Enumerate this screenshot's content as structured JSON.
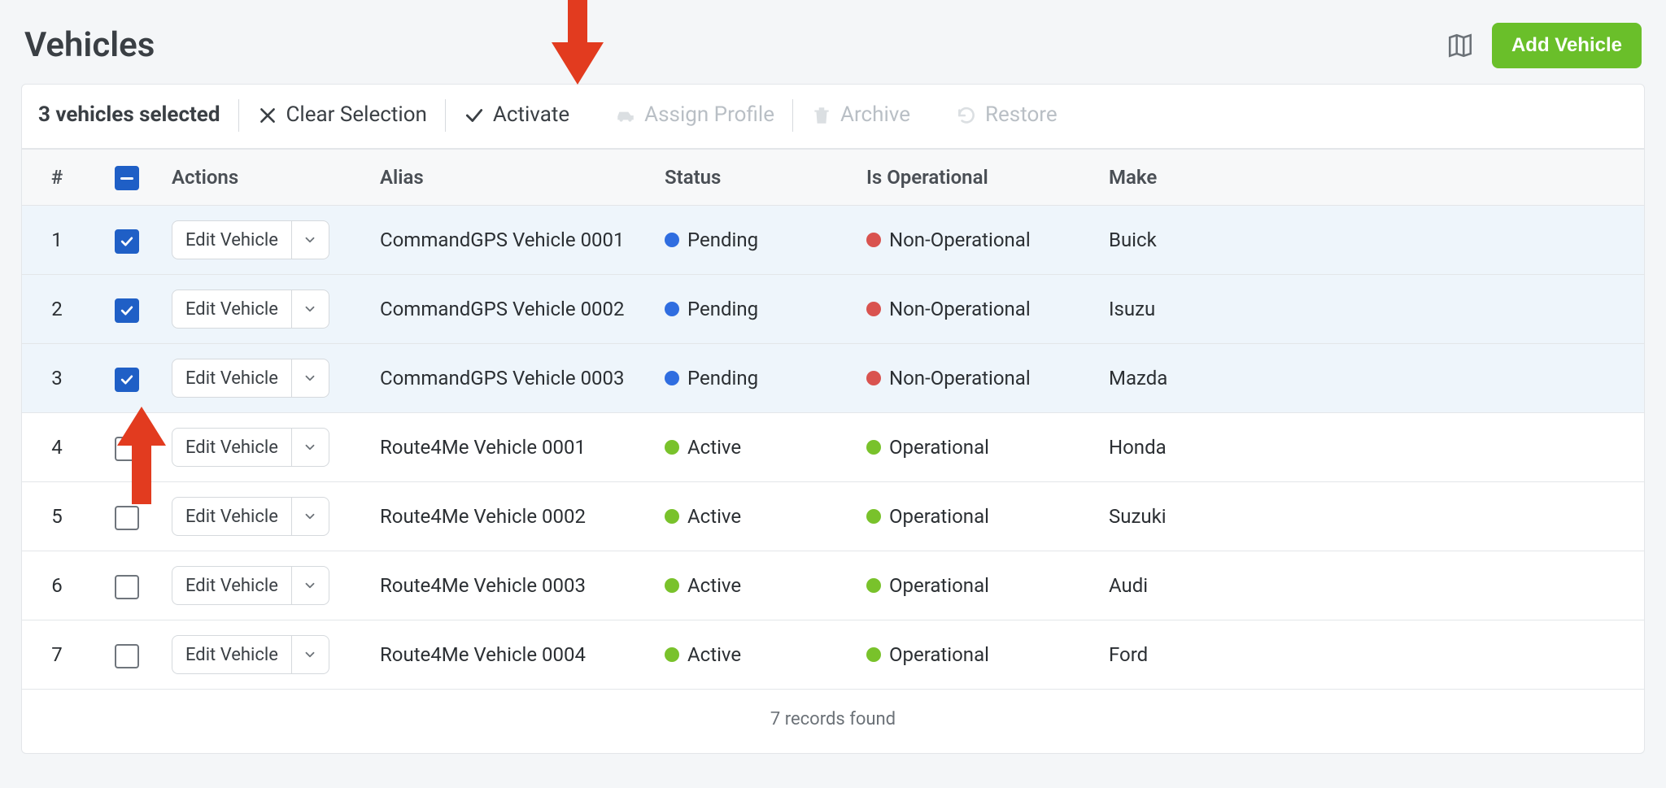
{
  "page": {
    "title": "Vehicles"
  },
  "header": {
    "add_button": "Add Vehicle"
  },
  "toolbar": {
    "selected_text": "3 vehicles selected",
    "clear_selection": "Clear Selection",
    "activate": "Activate",
    "assign_profile": "Assign Profile",
    "archive": "Archive",
    "restore": "Restore"
  },
  "columns": {
    "index": "#",
    "actions": "Actions",
    "alias": "Alias",
    "status": "Status",
    "operational": "Is Operational",
    "make": "Make"
  },
  "actions": {
    "edit_label": "Edit Vehicle"
  },
  "rows": [
    {
      "n": "1",
      "checked": true,
      "alias": "CommandGPS Vehicle 0001",
      "status": "Pending",
      "status_color": "blue",
      "op": "Non-Operational",
      "op_color": "red",
      "make": "Buick"
    },
    {
      "n": "2",
      "checked": true,
      "alias": "CommandGPS Vehicle 0002",
      "status": "Pending",
      "status_color": "blue",
      "op": "Non-Operational",
      "op_color": "red",
      "make": "Isuzu"
    },
    {
      "n": "3",
      "checked": true,
      "alias": "CommandGPS Vehicle 0003",
      "status": "Pending",
      "status_color": "blue",
      "op": "Non-Operational",
      "op_color": "red",
      "make": "Mazda"
    },
    {
      "n": "4",
      "checked": false,
      "alias": "Route4Me Vehicle 0001",
      "status": "Active",
      "status_color": "green",
      "op": "Operational",
      "op_color": "green",
      "make": "Honda"
    },
    {
      "n": "5",
      "checked": false,
      "alias": "Route4Me Vehicle 0002",
      "status": "Active",
      "status_color": "green",
      "op": "Operational",
      "op_color": "green",
      "make": "Suzuki"
    },
    {
      "n": "6",
      "checked": false,
      "alias": "Route4Me Vehicle 0003",
      "status": "Active",
      "status_color": "green",
      "op": "Operational",
      "op_color": "green",
      "make": "Audi"
    },
    {
      "n": "7",
      "checked": false,
      "alias": "Route4Me Vehicle 0004",
      "status": "Active",
      "status_color": "green",
      "op": "Operational",
      "op_color": "green",
      "make": "Ford"
    }
  ],
  "footer": {
    "records_text": "7 records found"
  },
  "colors": {
    "accent_blue": "#1f5fc6",
    "accent_green": "#6abf2a",
    "status_blue": "#2f6de0",
    "status_green": "#79c22b",
    "status_red": "#d9534f",
    "annotation_arrow": "#e23b1f"
  }
}
